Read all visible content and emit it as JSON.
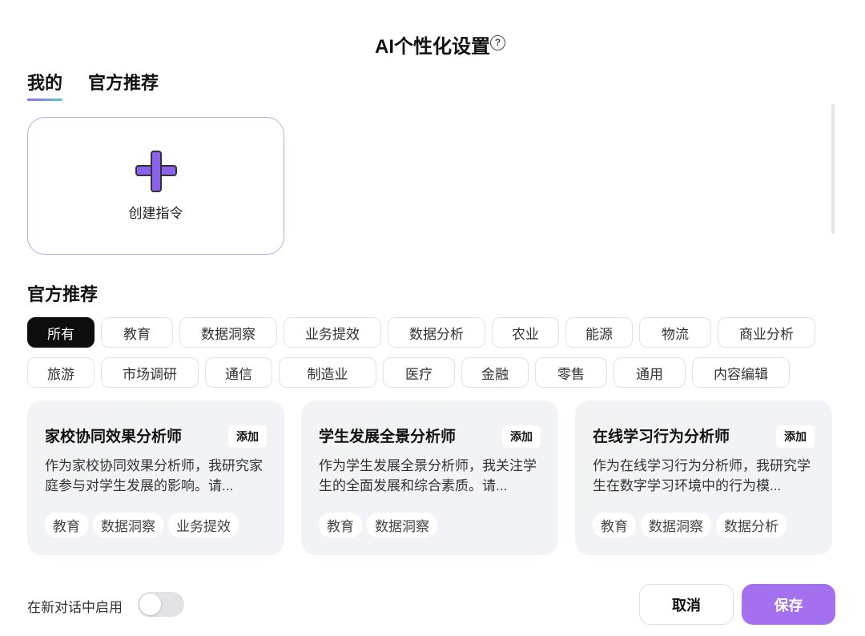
{
  "header": {
    "title": "AI个性化设置",
    "help_icon": "question-circle-icon",
    "help_glyph": "?"
  },
  "tabs": [
    {
      "label": "我的",
      "active": true
    },
    {
      "label": "官方推荐",
      "active": false
    }
  ],
  "create": {
    "label": "创建指令"
  },
  "section_title": "官方推荐",
  "categories_row1": [
    "所有",
    "教育",
    "数据洞察",
    "业务提效",
    "数据分析",
    "农业",
    "能源",
    "物流",
    "商业分析"
  ],
  "categories_row2": [
    "旅游",
    "市场调研",
    "通信",
    "制造业",
    "医疗",
    "金融",
    "零售",
    "通用",
    "内容编辑"
  ],
  "selected_category": "所有",
  "cards": [
    {
      "title": "家校协同效果分析师",
      "add": "添加",
      "desc": "作为家校协同效果分析师，我研究家庭参与对学生发展的影响。请...",
      "tags": [
        "教育",
        "数据洞察",
        "业务提效"
      ]
    },
    {
      "title": "学生发展全景分析师",
      "add": "添加",
      "desc": "作为学生发展全景分析师，我关注学生的全面发展和综合素质。请...",
      "tags": [
        "教育",
        "数据洞察"
      ]
    },
    {
      "title": "在线学习行为分析师",
      "add": "添加",
      "desc": "作为在线学习行为分析师，我研究学生在数字学习环境中的行为模...",
      "tags": [
        "教育",
        "数据洞察",
        "数据分析"
      ]
    }
  ],
  "footer": {
    "enable_label": "在新对话中启用",
    "enable_on": false,
    "cancel": "取消",
    "save": "保存"
  },
  "colors": {
    "accent": "#a570f0",
    "plus": "#8a62ec"
  }
}
